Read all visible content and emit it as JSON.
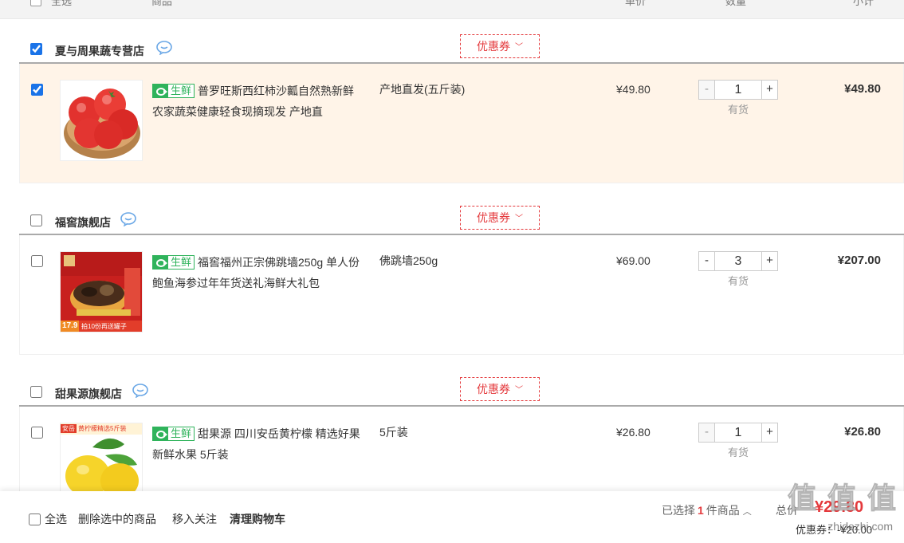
{
  "table_header": {
    "select": "全选",
    "product": "商品",
    "unit_price": "单价",
    "quantity": "数量",
    "subtotal": "小计"
  },
  "shops": [
    {
      "name": "夏与周果蔬专营店",
      "checked": true,
      "coupon_label": "优惠券",
      "items": [
        {
          "checked": true,
          "tag": "生鲜",
          "title": "普罗旺斯西红柿沙瓤自然熟新鲜农家蔬菜健康轻食现摘现发 产地直",
          "spec": "产地直发(五斤装)",
          "price": "¥49.80",
          "quantity": "1",
          "stock": "有货",
          "subtotal": "¥49.80",
          "thumb_icon": "tomato-image"
        }
      ]
    },
    {
      "name": "福窖旗舰店",
      "checked": false,
      "coupon_label": "优惠券",
      "items": [
        {
          "checked": false,
          "tag": "生鲜",
          "title": "福窖福州正宗佛跳墙250g 单人份鲍鱼海参过年年货送礼海鲜大礼包",
          "spec": "佛跳墙250g",
          "price": "¥69.00",
          "quantity": "3",
          "stock": "有货",
          "subtotal": "¥207.00",
          "thumb_icon": "fotiaoqiang-image",
          "thumb_badges": [
            "17.9",
            "拍10份再送罐子"
          ]
        }
      ]
    },
    {
      "name": "甜果源旗舰店",
      "checked": false,
      "coupon_label": "优惠券",
      "items": [
        {
          "checked": false,
          "tag": "生鲜",
          "title": "甜果源 四川安岳黄柠檬 精选好果新鲜水果 5斤装",
          "spec": "5斤装",
          "price": "¥26.80",
          "quantity": "1",
          "stock": "有货",
          "subtotal": "¥26.80",
          "thumb_icon": "lemon-image",
          "thumb_badges": [
            "安岳",
            "黄柠檬精选5斤装"
          ]
        }
      ]
    }
  ],
  "footer": {
    "select_all": "全选",
    "delete_selected": "删除选中的商品",
    "move_to_favorites": "移入关注",
    "clear_cart": "清理购物车",
    "selected_prefix": "已选择",
    "selected_count": "1",
    "selected_suffix": "件商品",
    "total_label": "总价",
    "total": "¥29.80",
    "discount_label": "优惠券",
    "discount": "-¥20.00"
  },
  "watermark": "值 值 值",
  "watermark_sub": "zhidezhi.com"
}
